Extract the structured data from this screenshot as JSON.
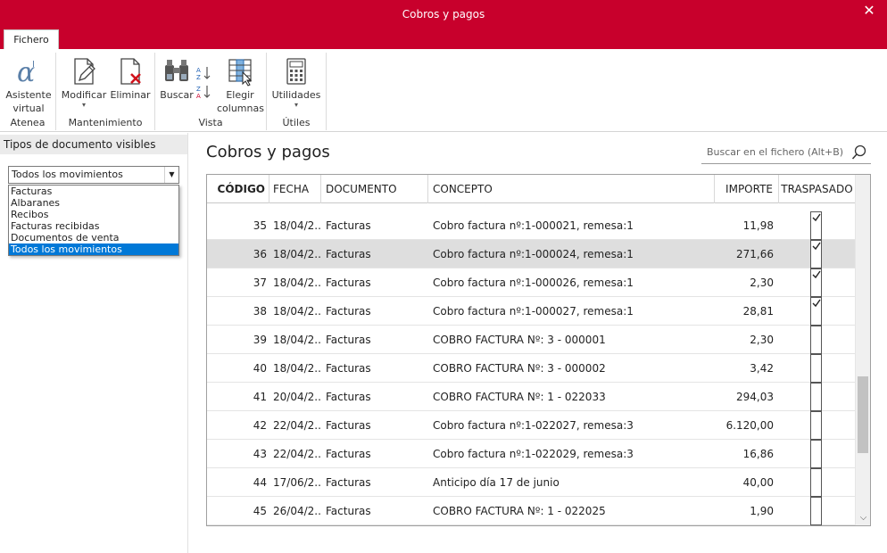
{
  "window": {
    "title": "Cobros y pagos"
  },
  "tabs": {
    "fichero": "Fichero"
  },
  "ribbon": {
    "asistente": "Asistente virtual",
    "modificar": "Modificar",
    "eliminar": "Eliminar",
    "buscar": "Buscar",
    "elegir": "Elegir columnas",
    "utilidades": "Utilidades",
    "groups": {
      "atenea": "Atenea",
      "mantenimiento": "Mantenimiento",
      "vista": "Vista",
      "utiles": "Útiles"
    }
  },
  "left_panel": {
    "header": "Tipos de documento visibles",
    "combo_value": "Todos los movimientos",
    "options": [
      "Facturas",
      "Albaranes",
      "Recibos",
      "Facturas recibidas",
      "Documentos de venta",
      "Todos los movimientos"
    ],
    "selected_index": 5
  },
  "main": {
    "title": "Cobros y pagos",
    "search_placeholder": "Buscar en el fichero (Alt+B)"
  },
  "table": {
    "columns": [
      "CÓDIGO",
      "FECHA",
      "DOCUMENTO",
      "CONCEPTO",
      "IMPORTE",
      "TRASPASADO"
    ],
    "rows": [
      {
        "codigo": "35",
        "fecha": "18/04/2...",
        "documento": "Facturas",
        "concepto": "Cobro factura nº:1-000021, remesa:1",
        "importe": "11,98",
        "traspasado": true
      },
      {
        "codigo": "36",
        "fecha": "18/04/2...",
        "documento": "Facturas",
        "concepto": "Cobro factura nº:1-000024, remesa:1",
        "importe": "271,66",
        "traspasado": true
      },
      {
        "codigo": "37",
        "fecha": "18/04/2...",
        "documento": "Facturas",
        "concepto": "Cobro factura nº:1-000026, remesa:1",
        "importe": "2,30",
        "traspasado": true
      },
      {
        "codigo": "38",
        "fecha": "18/04/2...",
        "documento": "Facturas",
        "concepto": "Cobro factura nº:1-000027, remesa:1",
        "importe": "28,81",
        "traspasado": true
      },
      {
        "codigo": "39",
        "fecha": "18/04/2...",
        "documento": "Facturas",
        "concepto": "COBRO FACTURA Nº: 3 - 000001",
        "importe": "2,30",
        "traspasado": false
      },
      {
        "codigo": "40",
        "fecha": "18/04/2...",
        "documento": "Facturas",
        "concepto": "COBRO FACTURA Nº: 3 - 000002",
        "importe": "3,42",
        "traspasado": false
      },
      {
        "codigo": "41",
        "fecha": "20/04/2...",
        "documento": "Facturas",
        "concepto": "COBRO FACTURA Nº: 1 - 022033",
        "importe": "294,03",
        "traspasado": false
      },
      {
        "codigo": "42",
        "fecha": "22/04/2...",
        "documento": "Facturas",
        "concepto": "Cobro factura nº:1-022027, remesa:3",
        "importe": "6.120,00",
        "traspasado": false
      },
      {
        "codigo": "43",
        "fecha": "22/04/2...",
        "documento": "Facturas",
        "concepto": "Cobro factura nº:1-022029, remesa:3",
        "importe": "16,86",
        "traspasado": false
      },
      {
        "codigo": "44",
        "fecha": "17/06/2...",
        "documento": "Facturas",
        "concepto": "Anticipo día 17 de junio",
        "importe": "40,00",
        "traspasado": false
      },
      {
        "codigo": "45",
        "fecha": "26/04/2...",
        "documento": "Facturas",
        "concepto": "COBRO FACTURA Nº: 1 - 022025",
        "importe": "1,90",
        "traspasado": false
      }
    ],
    "highlighted_row": 1
  },
  "colors": {
    "accent": "#c8002c",
    "selection": "#0078d7",
    "row_highlight": "#dedede"
  }
}
